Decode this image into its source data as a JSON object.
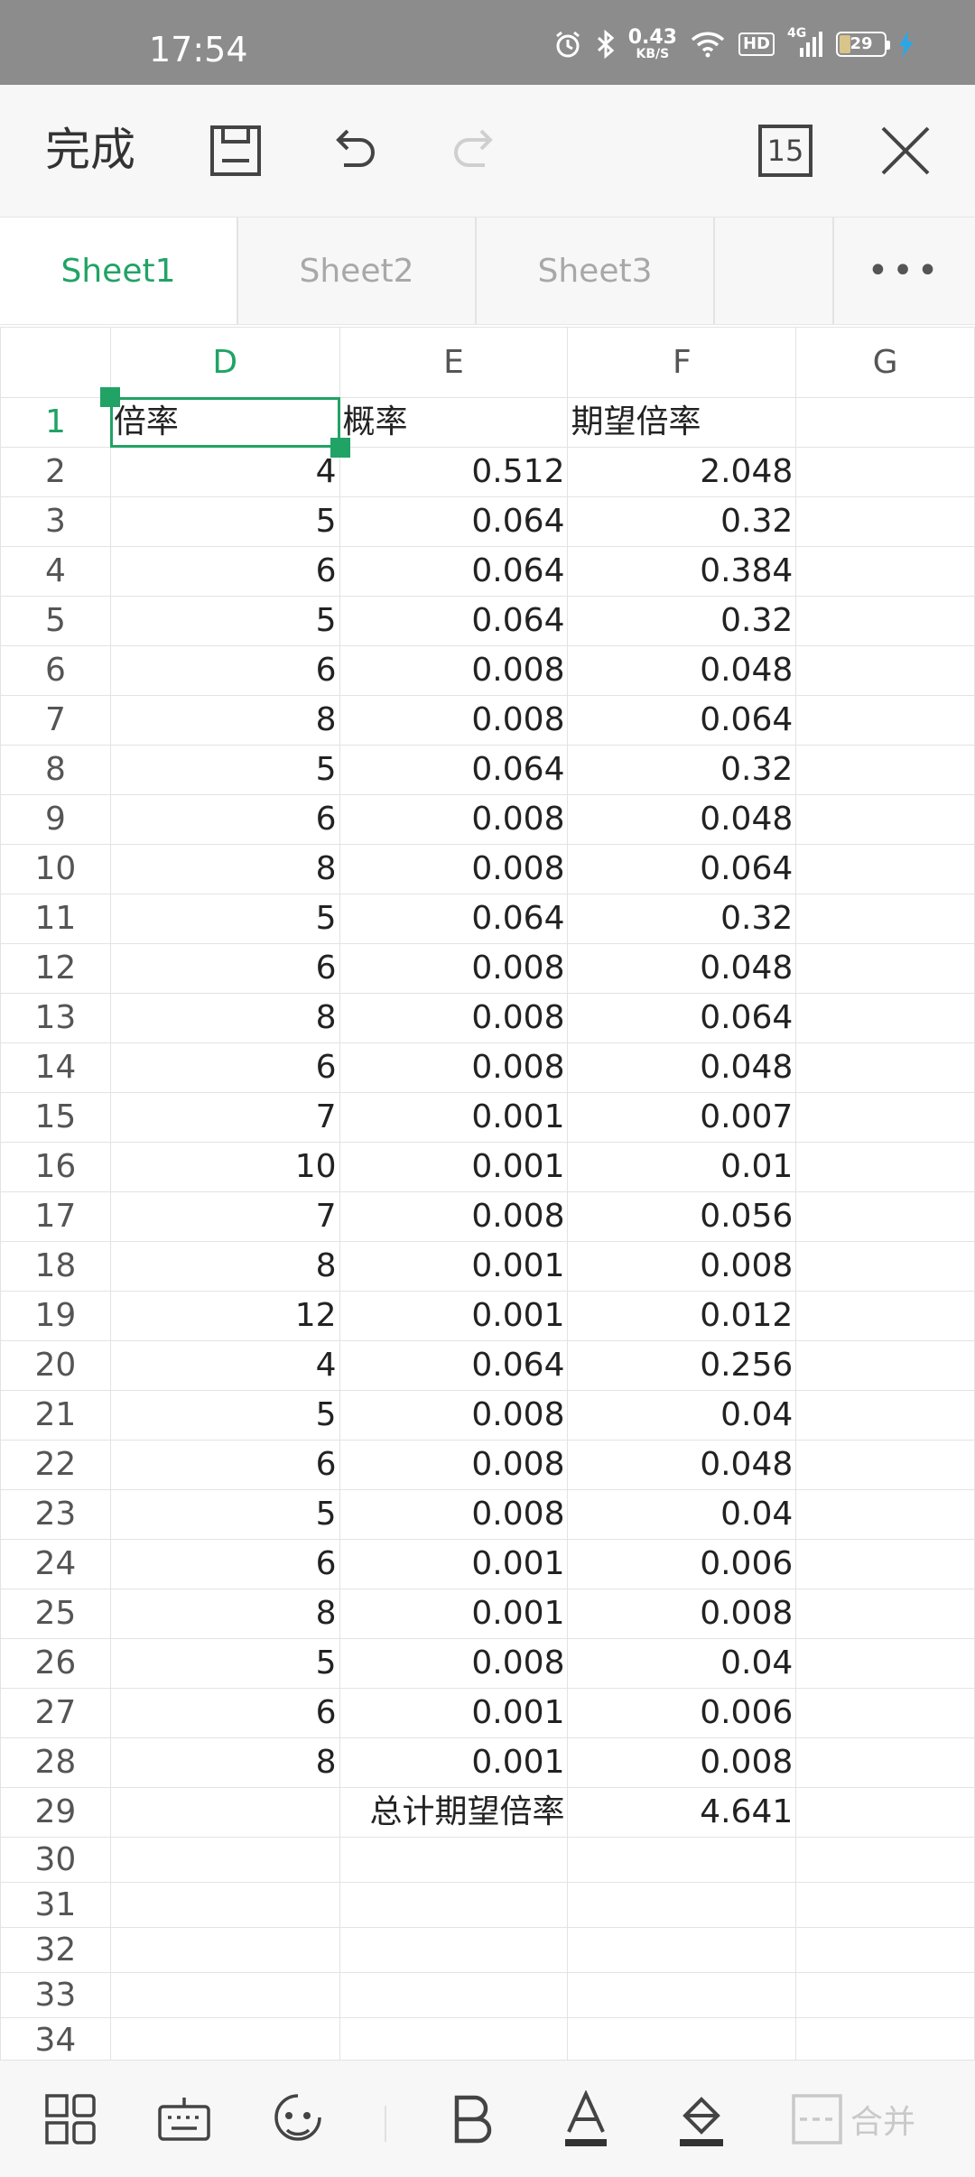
{
  "status_bar": {
    "time": "17:54",
    "net_speed_value": "0.43",
    "net_speed_unit": "KB/S",
    "hd_label": "HD",
    "network_type": "4G",
    "battery_level": "29",
    "icons": [
      "alarm-icon",
      "bluetooth-icon",
      "wifi-icon",
      "hd-badge",
      "signal-icon",
      "battery-icon",
      "charging-icon"
    ]
  },
  "toolbar": {
    "done_label": "完成",
    "sheet_count": "15",
    "icons": [
      "save-icon",
      "undo-icon",
      "redo-icon",
      "sheet-count-icon",
      "close-icon"
    ]
  },
  "tabs": {
    "items": [
      {
        "label": "Sheet1",
        "active": true
      },
      {
        "label": "Sheet2",
        "active": false
      },
      {
        "label": "Sheet3",
        "active": false
      }
    ],
    "more_label": "•••"
  },
  "grid": {
    "columns": [
      "D",
      "E",
      "F",
      "G"
    ],
    "selected_cell": "D1",
    "header_row": {
      "row": "1",
      "D": "倍率",
      "E": "概率",
      "F": "期望倍率"
    },
    "rows": [
      {
        "row": "2",
        "D": "4",
        "E": "0.512",
        "F": "2.048"
      },
      {
        "row": "3",
        "D": "5",
        "E": "0.064",
        "F": "0.32"
      },
      {
        "row": "4",
        "D": "6",
        "E": "0.064",
        "F": "0.384"
      },
      {
        "row": "5",
        "D": "5",
        "E": "0.064",
        "F": "0.32"
      },
      {
        "row": "6",
        "D": "6",
        "E": "0.008",
        "F": "0.048"
      },
      {
        "row": "7",
        "D": "8",
        "E": "0.008",
        "F": "0.064"
      },
      {
        "row": "8",
        "D": "5",
        "E": "0.064",
        "F": "0.32"
      },
      {
        "row": "9",
        "D": "6",
        "E": "0.008",
        "F": "0.048"
      },
      {
        "row": "10",
        "D": "8",
        "E": "0.008",
        "F": "0.064"
      },
      {
        "row": "11",
        "D": "5",
        "E": "0.064",
        "F": "0.32"
      },
      {
        "row": "12",
        "D": "6",
        "E": "0.008",
        "F": "0.048"
      },
      {
        "row": "13",
        "D": "8",
        "E": "0.008",
        "F": "0.064"
      },
      {
        "row": "14",
        "D": "6",
        "E": "0.008",
        "F": "0.048"
      },
      {
        "row": "15",
        "D": "7",
        "E": "0.001",
        "F": "0.007"
      },
      {
        "row": "16",
        "D": "10",
        "E": "0.001",
        "F": "0.01"
      },
      {
        "row": "17",
        "D": "7",
        "E": "0.008",
        "F": "0.056"
      },
      {
        "row": "18",
        "D": "8",
        "E": "0.001",
        "F": "0.008"
      },
      {
        "row": "19",
        "D": "12",
        "E": "0.001",
        "F": "0.012"
      },
      {
        "row": "20",
        "D": "4",
        "E": "0.064",
        "F": "0.256"
      },
      {
        "row": "21",
        "D": "5",
        "E": "0.008",
        "F": "0.04"
      },
      {
        "row": "22",
        "D": "6",
        "E": "0.008",
        "F": "0.048"
      },
      {
        "row": "23",
        "D": "5",
        "E": "0.008",
        "F": "0.04"
      },
      {
        "row": "24",
        "D": "6",
        "E": "0.001",
        "F": "0.006"
      },
      {
        "row": "25",
        "D": "8",
        "E": "0.001",
        "F": "0.008"
      },
      {
        "row": "26",
        "D": "5",
        "E": "0.008",
        "F": "0.04"
      },
      {
        "row": "27",
        "D": "6",
        "E": "0.001",
        "F": "0.006"
      },
      {
        "row": "28",
        "D": "8",
        "E": "0.001",
        "F": "0.008"
      }
    ],
    "total_row": {
      "row": "29",
      "label": "总计期望倍率",
      "value": "4.641"
    },
    "empty_rows": [
      "30",
      "31",
      "32",
      "33",
      "34"
    ]
  },
  "bottom_toolbar": {
    "merge_label": "合并",
    "icons": [
      "layout-icon",
      "keyboard-icon",
      "ai-assistant-icon",
      "bold-icon",
      "font-color-icon",
      "fill-color-icon",
      "merge-cells-icon"
    ]
  },
  "colors": {
    "accent": "#21a366",
    "status_bar": "#8c8c8c",
    "toolbar_bg": "#f7f7f7",
    "grid_line": "#e3e3e3"
  }
}
